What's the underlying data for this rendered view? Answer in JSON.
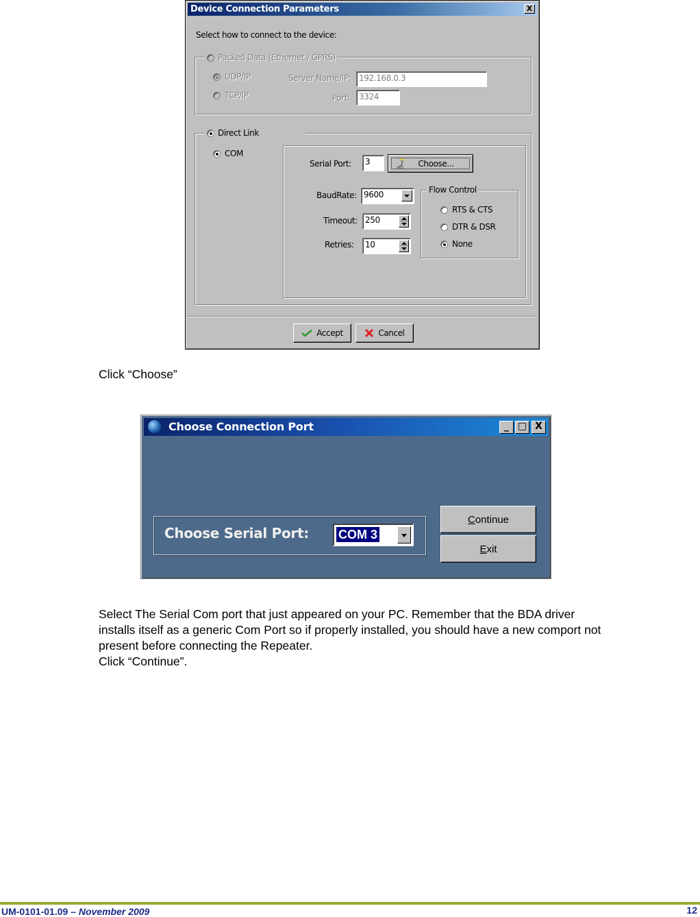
{
  "dialog1": {
    "title": "Device Connection Parameters",
    "close_label": "X",
    "prompt": "Select how to connect to the device:",
    "packed_group": {
      "label": "Packed Data (Ethernet / GPRS)",
      "selected": false,
      "enabled": false,
      "protocols": [
        {
          "label": "UDP/IP",
          "selected": true
        },
        {
          "label": "TCP/IP",
          "selected": false
        }
      ],
      "server_label": "Server Name/IP:",
      "server_value": "192.168.0.3",
      "port_label": "Port:",
      "port_value": "3324"
    },
    "direct_group": {
      "label": "Direct Link",
      "selected": true,
      "com_label": "COM",
      "com_selected": true,
      "serial_port_label": "Serial Port:",
      "serial_port_value": "3",
      "choose_label": "Choose...",
      "baudrate_label": "BaudRate:",
      "baudrate_value": "9600",
      "timeout_label": "Timeout:",
      "timeout_value": "250",
      "retries_label": "Retries:",
      "retries_value": "10",
      "flow_control": {
        "label": "Flow Control",
        "options": [
          {
            "label": "RTS & CTS",
            "selected": false
          },
          {
            "label": "DTR & DSR",
            "selected": false
          },
          {
            "label": "None",
            "selected": true
          }
        ]
      }
    },
    "accept_label": "Accept",
    "cancel_label": "Cancel"
  },
  "instruction1": "Click “Choose”",
  "dialog2": {
    "title": "Choose Connection Port",
    "minimize_label": "_",
    "maximize_label": "□",
    "close_label": "X",
    "port_label": "Choose Serial Port:",
    "port_value": "COM 3",
    "continue_label_first": "C",
    "continue_label_rest": "ontinue",
    "exit_label_first": "E",
    "exit_label_rest": "xit"
  },
  "instruction2": {
    "lines": [
      "Select The Serial Com port that just appeared on your PC. Remember that the BDA driver",
      "installs itself as a generic Com Port so if properly installed, you should have a new comport not",
      "present before connecting the Repeater.",
      "Click “Continue”."
    ]
  },
  "footer": {
    "doc_id": "UM-0101-01.09 – ",
    "date": "November 2009",
    "page_number": "12",
    "rule_color": "#99a830",
    "text_color": "#1a2a8a"
  }
}
